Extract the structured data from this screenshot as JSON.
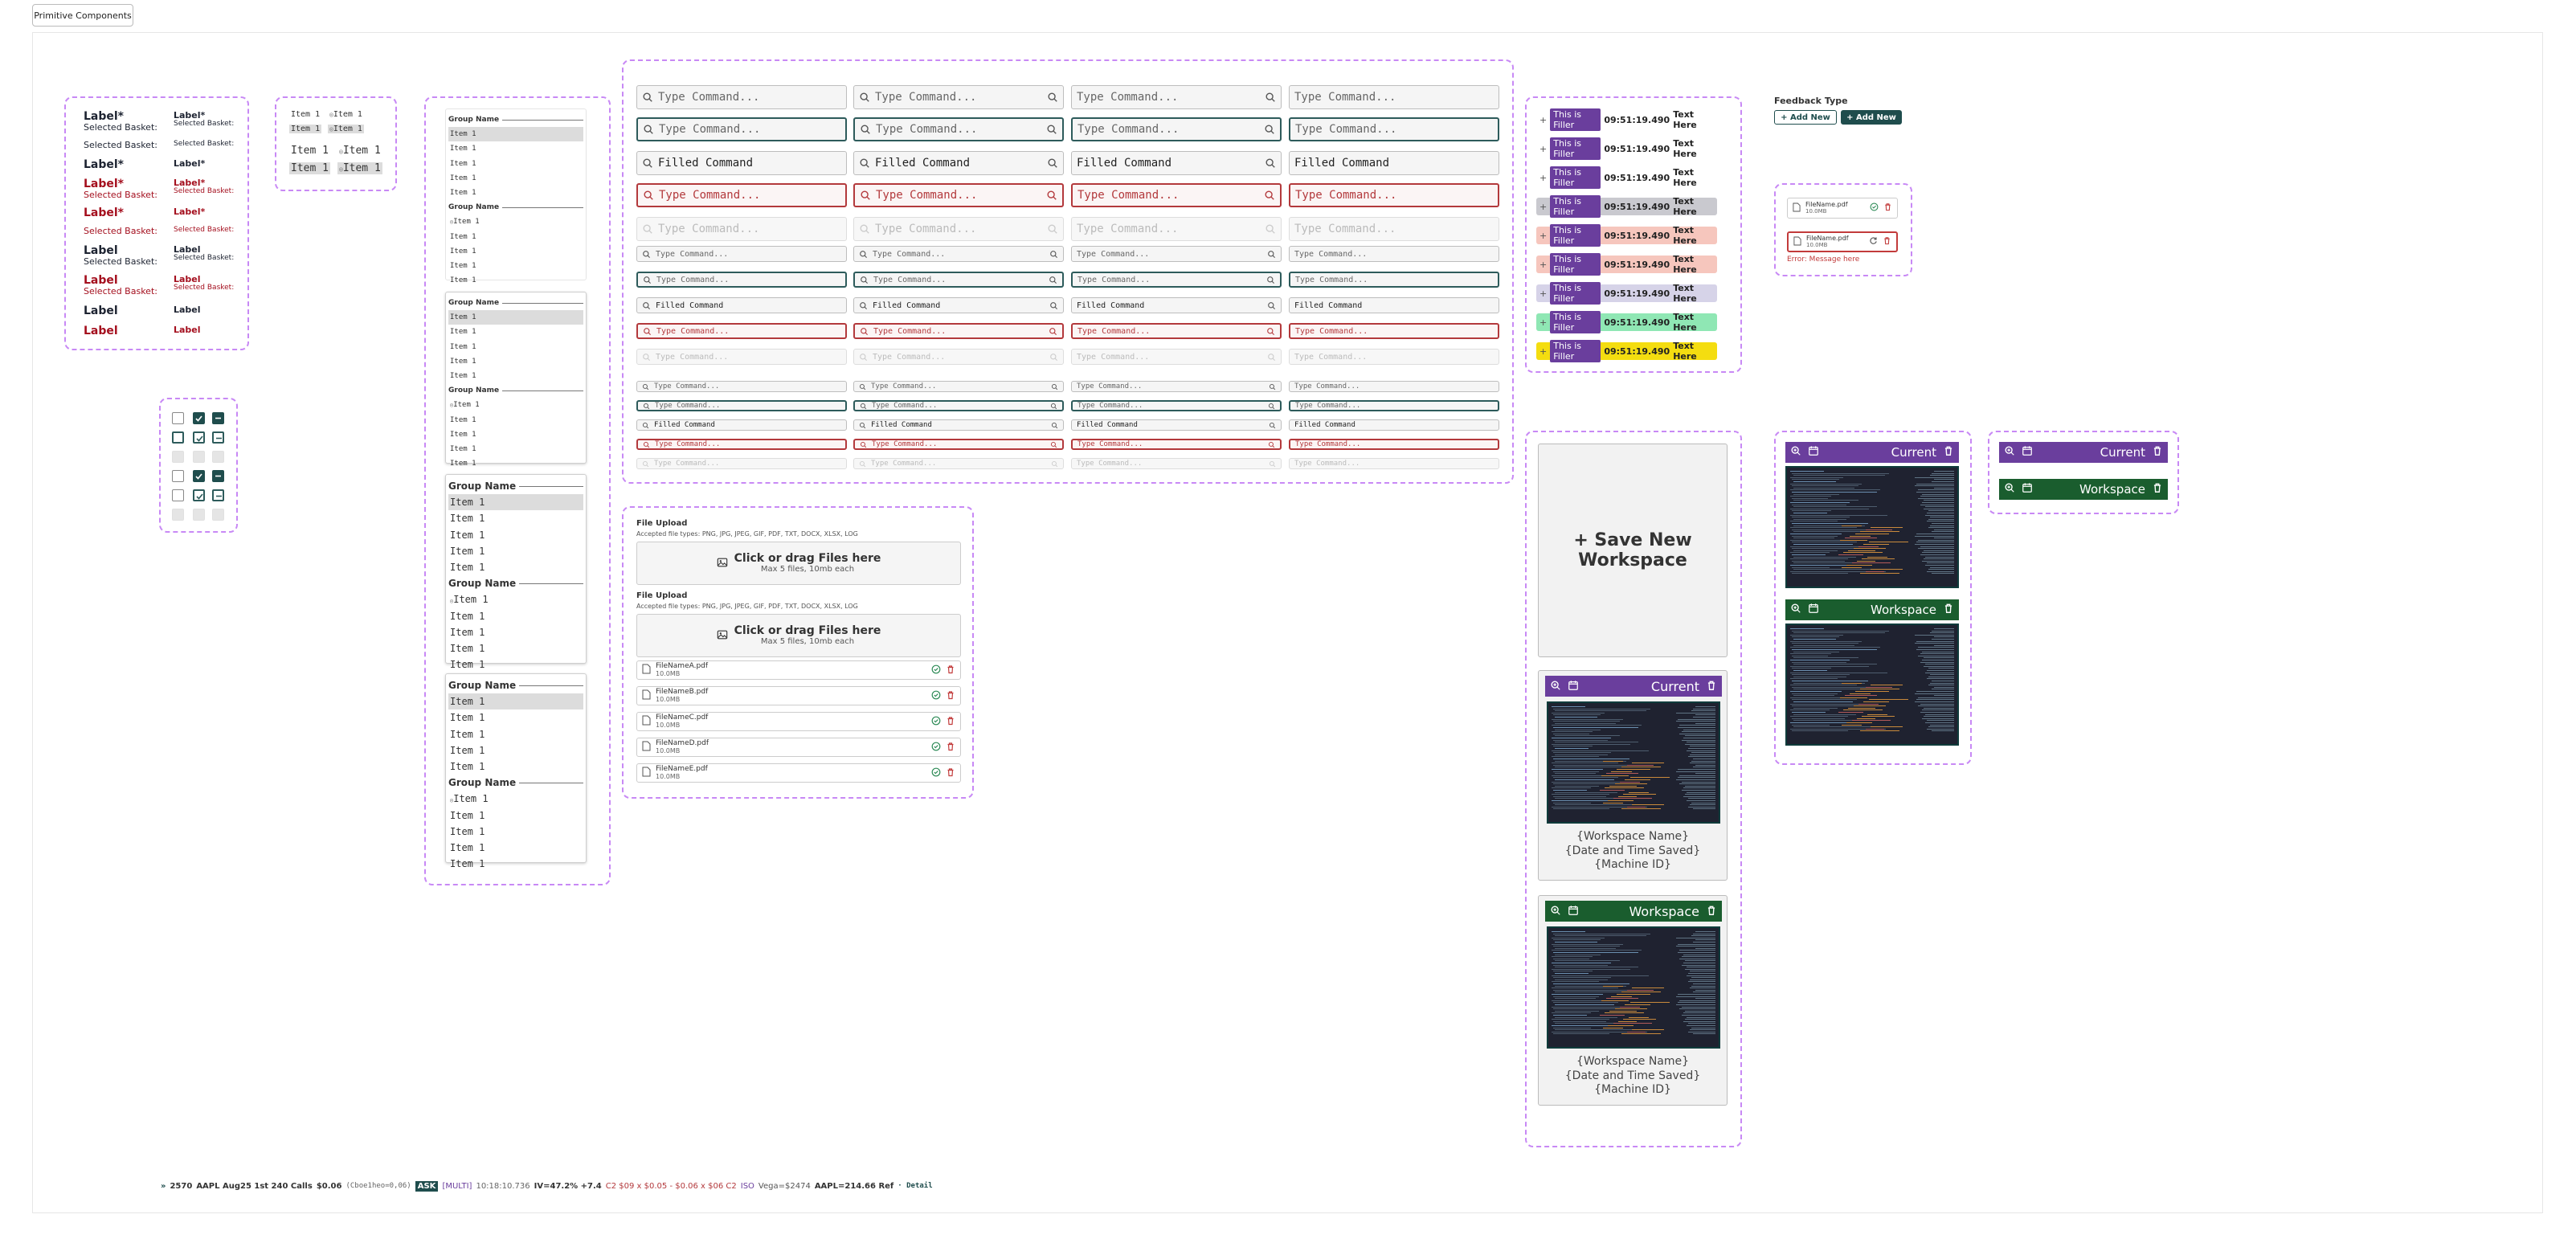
{
  "tab": "Primitive Components",
  "labels": {
    "label": "Label",
    "label_req": "Label*",
    "sub": "Selected Basket:"
  },
  "list_item": "Item 1",
  "group_name": "Group Name",
  "command": {
    "placeholder": "Type Command...",
    "filled": "Filled Command"
  },
  "badges": {
    "pill": "This is Filler",
    "time": "09:51:19.490",
    "text": "Text Here",
    "rows": [
      {
        "bg": "#ffffff",
        "mark": "+"
      },
      {
        "bg": "#ffffff",
        "mark": "+"
      },
      {
        "bg": "#ffffff",
        "mark": "+"
      },
      {
        "bg": "#c9c9cf",
        "mark": "+"
      },
      {
        "bg": "#f6c6bd",
        "mark": "+"
      },
      {
        "bg": "#f6c6bd",
        "mark": "+"
      },
      {
        "bg": "#d6d3e8",
        "mark": "+"
      },
      {
        "bg": "#8fe7b4",
        "mark": "+"
      },
      {
        "bg": "#f4dd10",
        "mark": "+"
      }
    ]
  },
  "feedback": {
    "title": "Feedback Type",
    "add1": "+ Add New",
    "add2": "+ Add New"
  },
  "file_small": {
    "name": "FileName.pdf",
    "size": "10.0MB",
    "error": "Error: Message here"
  },
  "upload": {
    "title": "File Upload",
    "types": "Accepted file types: PNG, JPG, JPEG, GIF, PDF, TXT, DOCX, XLSX, LOG",
    "drop": "Click or drag Files here",
    "limit": "Max 5 files, 10mb each",
    "files": [
      {
        "name": "FileNameA.pdf",
        "size": "10.0MB"
      },
      {
        "name": "FileNameB.pdf",
        "size": "10.0MB"
      },
      {
        "name": "FileNameC.pdf",
        "size": "10.0MB"
      },
      {
        "name": "FileNameD.pdf",
        "size": "10.0MB"
      },
      {
        "name": "FileNameE.pdf",
        "size": "10.0MB"
      }
    ]
  },
  "workspace": {
    "save": "+ Save New Workspace",
    "current": "Current",
    "ws": "Workspace",
    "name": "{Workspace Name}",
    "date": "{Date and Time Saved}",
    "machine": "{Machine ID}"
  },
  "colors": {
    "purple": "#6a3e9d",
    "green": "#1a5d2e",
    "teal": "#1f4d4d",
    "red": "#a40f1e",
    "dashed": "#c889f5"
  },
  "ticker": {
    "arrow": "»",
    "qty": "2570",
    "desc": "AAPL Aug25 1st 240 Calls",
    "px": "$0.06",
    "greek": "(Cboe1heo=0,06)",
    "side": "ASK",
    "multi": "[MULTI]",
    "time": "10:18:10.736",
    "iv": "IV=47.2% +7.4",
    "c2": "C2 $09 x $0.05 - $0.06 x $06 C2",
    "iso": "ISO",
    "vega": "Vega=$2474",
    "ref": "AAPL=214.66 Ref",
    "detail": "· Detail"
  }
}
